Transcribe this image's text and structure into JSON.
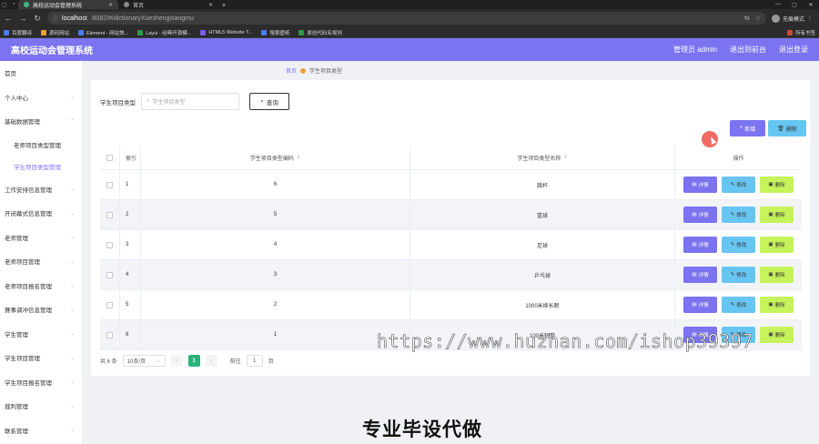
{
  "browser": {
    "tabs": [
      {
        "label": "高校运动会管理系统"
      },
      {
        "label": "首页"
      }
    ],
    "url_host": "localhost",
    "url_path": ":8082/#/dictionaryXueshengxiangmu",
    "profile_label": "无痕模式",
    "bookmarks": [
      {
        "label": "百度翻译"
      },
      {
        "label": "源码网站"
      },
      {
        "label": "Element - 网站快..."
      },
      {
        "label": "Layui - 经典开源模..."
      },
      {
        "label": "HTML5 Website T..."
      },
      {
        "label": "搜索壁纸"
      },
      {
        "label": "原创代码名规则"
      }
    ],
    "all_bookmarks": "所有书签"
  },
  "header": {
    "title": "高校运动会管理系统",
    "admin": "管理员 admin",
    "backend": "退出到前台",
    "logout": "退出登录"
  },
  "sidebar": {
    "items": [
      {
        "label": "首页"
      },
      {
        "label": "个人中心"
      },
      {
        "label": "基础数据管理"
      },
      {
        "label": "老师项目类型管理"
      },
      {
        "label": "学生项目类型管理"
      },
      {
        "label": "工作安排信息管理"
      },
      {
        "label": "开闭幕式信息管理"
      },
      {
        "label": "老师管理"
      },
      {
        "label": "老师项目管理"
      },
      {
        "label": "老师项目报名管理"
      },
      {
        "label": "赛事调冲信息管理"
      },
      {
        "label": "学生管理"
      },
      {
        "label": "学生项目管理"
      },
      {
        "label": "学生项目报名管理"
      },
      {
        "label": "裁判管理"
      },
      {
        "label": "联系管理"
      }
    ]
  },
  "breadcrumb": {
    "home": "首页",
    "current": "学生项目类型"
  },
  "search": {
    "label": "学生项目类型",
    "placeholder": "学生项目类型",
    "query_label": "查询"
  },
  "actions": {
    "add_label": "新增",
    "delete_label": "删除"
  },
  "table": {
    "headers": {
      "index": "索引",
      "code": "学生项目类型编码",
      "name": "学生项目类型名称",
      "ops": "操作"
    },
    "op_labels": {
      "detail": "详情",
      "edit": "修改",
      "remove": "删除"
    },
    "rows": [
      {
        "index": "1",
        "code": "6",
        "name": "跳杆"
      },
      {
        "index": "2",
        "code": "5",
        "name": "篮球"
      },
      {
        "index": "3",
        "code": "4",
        "name": "足球"
      },
      {
        "index": "4",
        "code": "3",
        "name": "乒乓球"
      },
      {
        "index": "5",
        "code": "2",
        "name": "1000米续长跑"
      },
      {
        "index": "6",
        "code": "1",
        "name": "100米短跑"
      }
    ]
  },
  "pagination": {
    "total": "共 6 条",
    "page_size": "10条/页",
    "prev": "‹",
    "current": "1",
    "next": "›",
    "goto_label": "前往",
    "goto_value": "1",
    "page_suffix": "页"
  },
  "watermark": "https://www.huzhan.com/ishop39397",
  "caption": "专业毕设代做"
}
